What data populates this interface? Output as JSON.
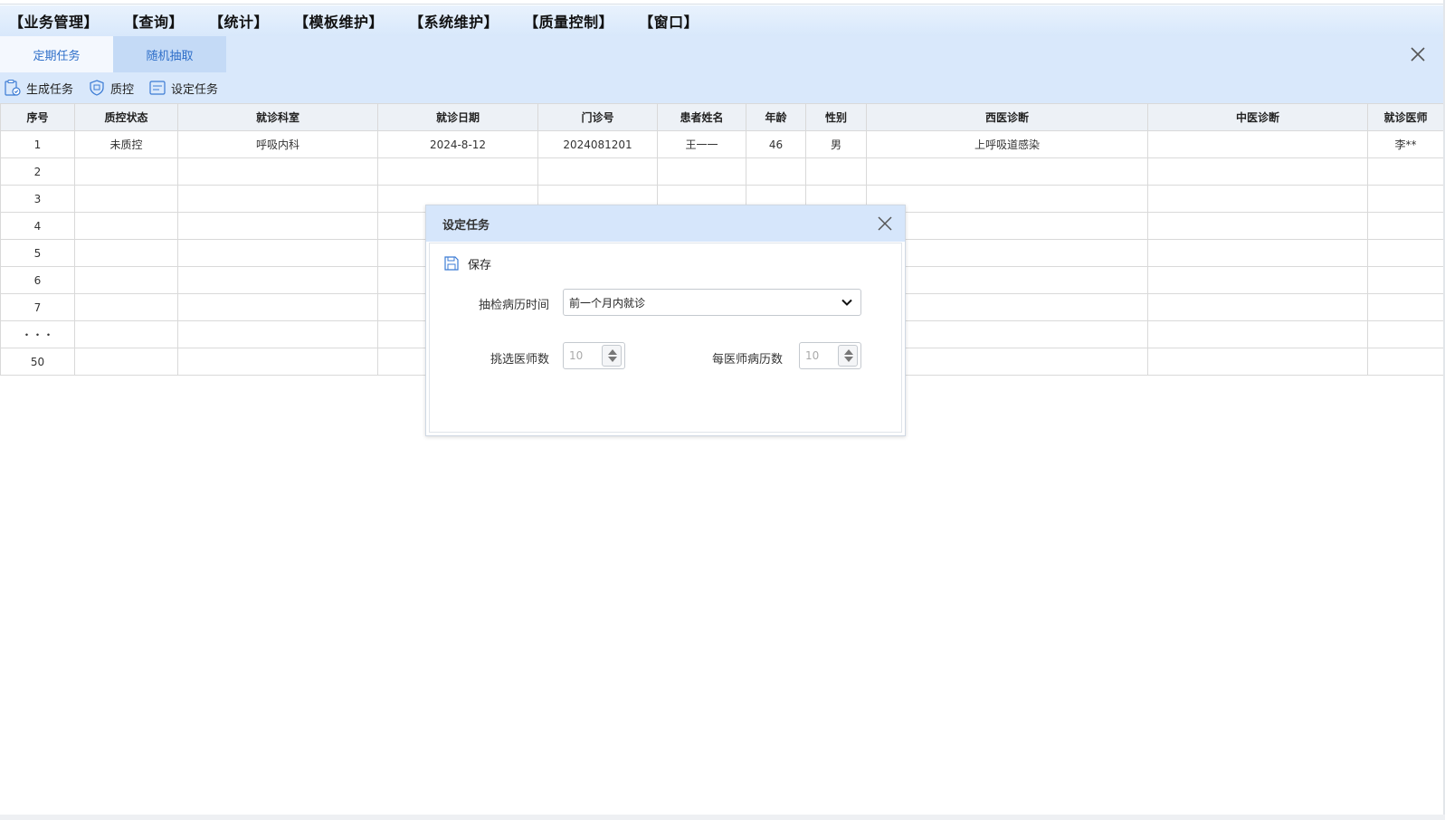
{
  "menu": [
    "【业务管理】",
    "【查询】",
    "【统计】",
    "【模板维护】",
    "【系统维护】",
    "【质量控制】",
    "【窗口】"
  ],
  "tabs": [
    {
      "label": "定期任务",
      "active": true
    },
    {
      "label": "随机抽取",
      "active": false
    }
  ],
  "toolbar": {
    "generate_label": "生成任务",
    "qc_label": "质控",
    "set_task_label": "设定任务"
  },
  "table": {
    "columns": [
      "序号",
      "质控状态",
      "就诊科室",
      "就诊日期",
      "门诊号",
      "患者姓名",
      "年龄",
      "性别",
      "西医诊断",
      "中医诊断",
      "就诊医师"
    ],
    "rows": [
      [
        "1",
        "未质控",
        "呼吸内科",
        "2024-8-12",
        "2024081201",
        "王一一",
        "46",
        "男",
        "上呼吸道感染",
        "",
        "李**"
      ],
      [
        "2",
        "",
        "",
        "",
        "",
        "",
        "",
        "",
        "",
        "",
        ""
      ],
      [
        "3",
        "",
        "",
        "",
        "",
        "",
        "",
        "",
        "",
        "",
        ""
      ],
      [
        "4",
        "",
        "",
        "",
        "",
        "",
        "",
        "",
        "",
        "",
        ""
      ],
      [
        "5",
        "",
        "",
        "",
        "",
        "",
        "",
        "",
        "",
        "",
        ""
      ],
      [
        "6",
        "",
        "",
        "",
        "",
        "",
        "",
        "",
        "",
        "",
        ""
      ],
      [
        "7",
        "",
        "",
        "",
        "",
        "",
        "",
        "",
        "",
        "",
        ""
      ],
      [
        "・・・",
        "",
        "",
        "",
        "",
        "",
        "",
        "",
        "",
        "",
        ""
      ],
      [
        "50",
        "",
        "",
        "",
        "",
        "",
        "",
        "",
        "",
        "",
        ""
      ]
    ]
  },
  "dialog": {
    "title": "设定任务",
    "save_label": "保存",
    "time_label": "抽检病历时间",
    "time_value": "前一个月内就诊",
    "doctor_count_label": "挑选医师数",
    "doctor_count_value": "10",
    "records_per_doctor_label": "每医师病历数",
    "records_per_doctor_value": "10"
  },
  "colors": {
    "menubar": "#d8e8fb",
    "tab_active_text": "#2f6fc9",
    "dialog_header": "#d6e6fb",
    "table_header": "#edf1f6"
  }
}
